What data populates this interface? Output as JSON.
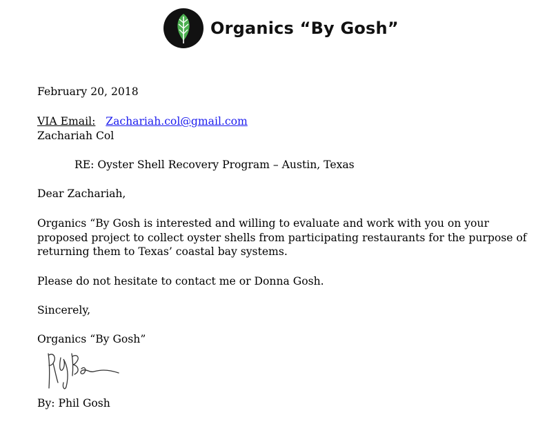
{
  "letterhead": {
    "logo_icon": "leaf-icon",
    "logo_colors": {
      "circle": "#111111",
      "leaf": "#4caf50",
      "vein": "#ffffff"
    },
    "company_name": "Organics “By Gosh”"
  },
  "letter": {
    "date": "February 20, 2018",
    "via_label": "VIA Email:",
    "via_email": "Zachariah.col@gmail.com",
    "link_color": "#1a1aee",
    "recipient_name": "Zachariah Col",
    "re_line": "RE:  Oyster Shell Recovery Program – Austin, Texas",
    "salutation": "Dear Zachariah,",
    "body_paragraph": "Organics “By Gosh is interested and willing to evaluate and work with you on your proposed project to collect oyster shells from participating restaurants for the purpose of returning them to Texas’ coastal bay systems.",
    "contact_line": "Please do not hesitate to contact me or Donna Gosh.",
    "closing": "Sincerely,",
    "company_signoff": "Organics “By Gosh”",
    "signature_text": "Phil Gosh",
    "byline": "By:  Phil Gosh"
  }
}
